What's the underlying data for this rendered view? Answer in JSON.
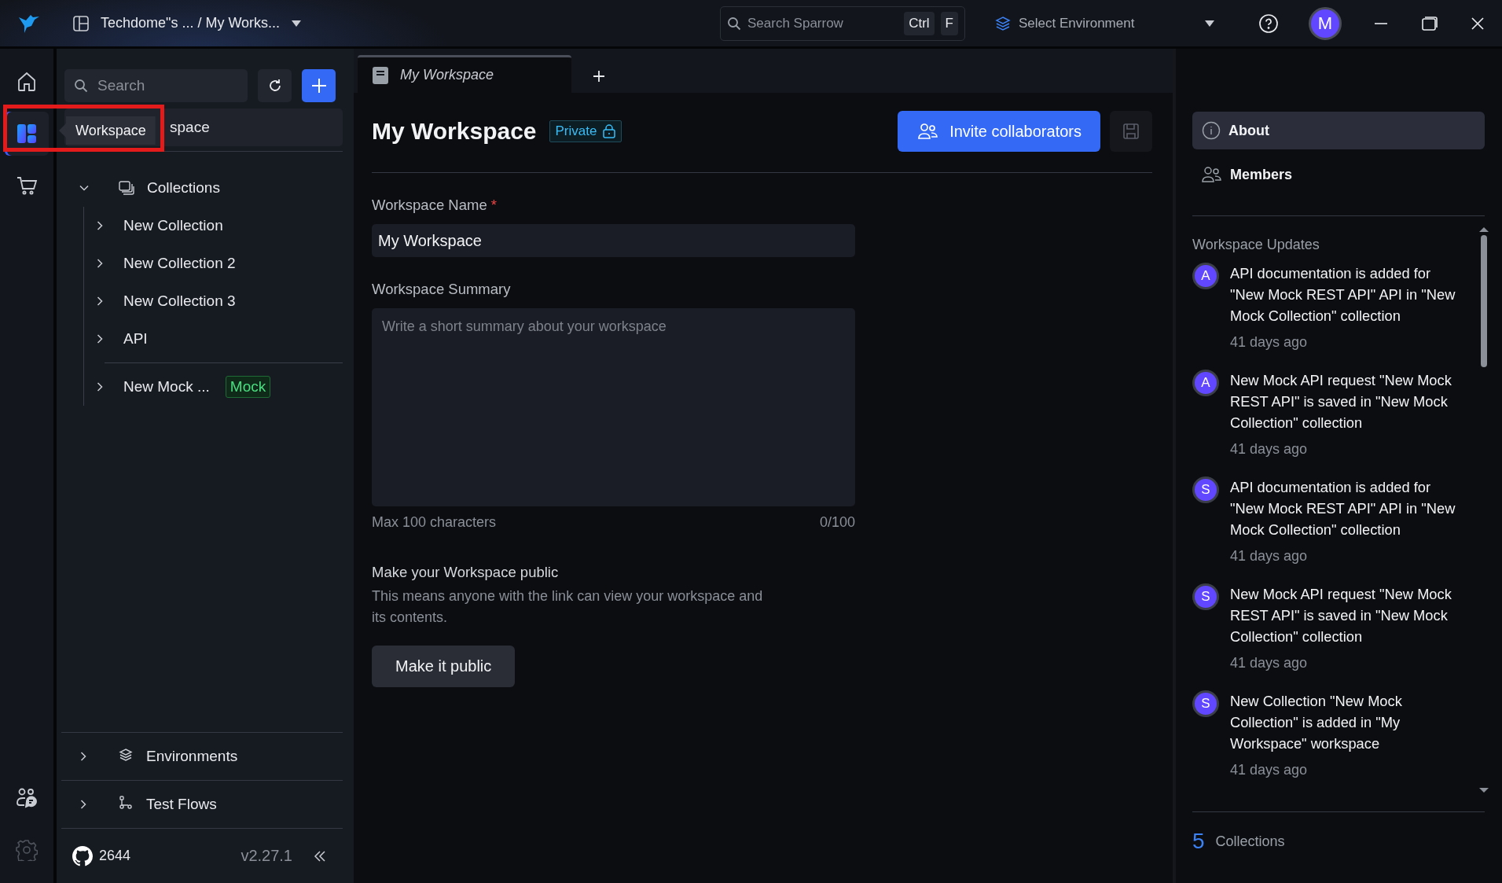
{
  "topbar": {
    "breadcrumb": "Techdome\"s ... / My Works...",
    "search": {
      "placeholder": "Search Sparrow",
      "keys": [
        "Ctrl",
        "F"
      ]
    },
    "environment": "Select Environment",
    "avatar": "M"
  },
  "rail": {
    "items": [
      {
        "kind": "home",
        "selected": false
      },
      {
        "kind": "workspace",
        "selected": true
      },
      {
        "kind": "cart",
        "selected": false
      }
    ],
    "bottom": [
      {
        "kind": "team"
      },
      {
        "kind": "settings"
      }
    ]
  },
  "tooltip": {
    "text": "Workspace",
    "highlighted": true
  },
  "sidebar": {
    "search": {
      "placeholder": "Search"
    },
    "workspace_item": "space",
    "collections": {
      "label": "Collections",
      "expanded": true,
      "children": [
        {
          "label": "New Collection",
          "expanded": false
        },
        {
          "label": "New Collection 2",
          "expanded": false
        },
        {
          "label": "New Collection 3",
          "expanded": false
        },
        {
          "label": "API",
          "expanded": false
        },
        {
          "label": "New Mock ...",
          "expanded": false,
          "badge": "Mock"
        }
      ]
    },
    "sections": [
      {
        "kind": "environments",
        "label": "Environments",
        "expanded": false
      },
      {
        "kind": "testflows",
        "label": "Test Flows",
        "expanded": false
      }
    ],
    "footer": {
      "github_count": "2644",
      "version": "v2.27.1"
    }
  },
  "tabs": [
    {
      "label": "My Workspace",
      "selected": true
    }
  ],
  "workspace": {
    "title": "My Workspace",
    "visibility": "Private",
    "invite_button": "Invite collaborators",
    "name_field": {
      "label": "Workspace Name",
      "required": true,
      "required_mark": "*",
      "value": "My Workspace"
    },
    "summary_field": {
      "label": "Workspace Summary",
      "placeholder": "Write a short summary about your workspace",
      "hint": "Max 100 characters",
      "counter": "0/100"
    },
    "public_section": {
      "title": "Make your Workspace public",
      "description": "This means anyone with the link can view your workspace and its contents.",
      "button": "Make it public"
    }
  },
  "details": {
    "tabs": [
      {
        "kind": "about",
        "label": "About",
        "selected": true
      },
      {
        "kind": "members",
        "label": "Members",
        "selected": false
      }
    ],
    "updates_title": "Workspace Updates",
    "updates": [
      {
        "avatar": "A",
        "text": "API documentation is added for \"New Mock REST API\" API in \"New Mock Collection\" collection",
        "time": "41 days ago"
      },
      {
        "avatar": "A",
        "text": "New Mock API request \"New Mock REST API\" is saved in \"New Mock Collection\" collection",
        "time": "41 days ago"
      },
      {
        "avatar": "S",
        "text": "API documentation is added for \"New Mock REST API\" API in \"New Mock Collection\" collection",
        "time": "41 days ago"
      },
      {
        "avatar": "S",
        "text": "New Mock API request \"New Mock REST API\" is saved in \"New Mock Collection\" collection",
        "time": "41 days ago"
      },
      {
        "avatar": "S",
        "text": "New Collection \"New Mock Collection\" is added in \"My Workspace\" workspace",
        "time": "41 days ago"
      }
    ],
    "summary": {
      "count": "5",
      "label": "Collections"
    }
  }
}
